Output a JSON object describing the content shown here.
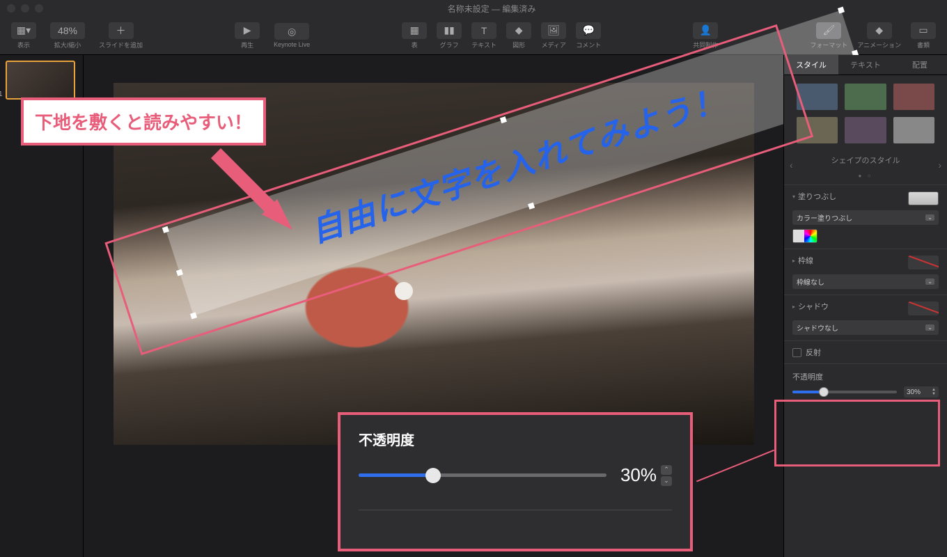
{
  "window": {
    "title": "名称未設定 — 編集済み"
  },
  "toolbar": {
    "view": "表示",
    "zoom_value": "48%",
    "zoom_label": "拡大/縮小",
    "add_slide": "スライドを追加",
    "play": "再生",
    "keynote_live": "Keynote Live",
    "table": "表",
    "chart": "グラフ",
    "text": "テキスト",
    "shape": "図形",
    "media": "メディア",
    "comment": "コメント",
    "collab": "共同制作",
    "format": "フォーマット",
    "animation": "アニメーション",
    "document": "書類"
  },
  "inspector": {
    "tabs": {
      "style": "スタイル",
      "text": "テキスト",
      "arrange": "配置"
    },
    "shape_style_label": "シェイプのスタイル",
    "swatch_colors": [
      "#4a5a6e",
      "#4d6b4d",
      "#7a4a4a",
      "#6b6554",
      "#5a4a5e",
      "#888888"
    ],
    "fill": {
      "title": "塗りつぶし",
      "mode": "カラー塗りつぶし"
    },
    "border": {
      "title": "枠線",
      "mode": "枠線なし"
    },
    "shadow": {
      "title": "シャドウ",
      "mode": "シャドウなし"
    },
    "reflection": "反射",
    "opacity": {
      "label": "不透明度",
      "value": "30%",
      "percent": 30
    }
  },
  "canvas": {
    "overlay_text": "自由に文字を入れてみよう！"
  },
  "annotations": {
    "callout": "下地を敷くと読みやすい！",
    "opacity_title": "不透明度",
    "opacity_value": "30%",
    "opacity_percent": 30
  }
}
